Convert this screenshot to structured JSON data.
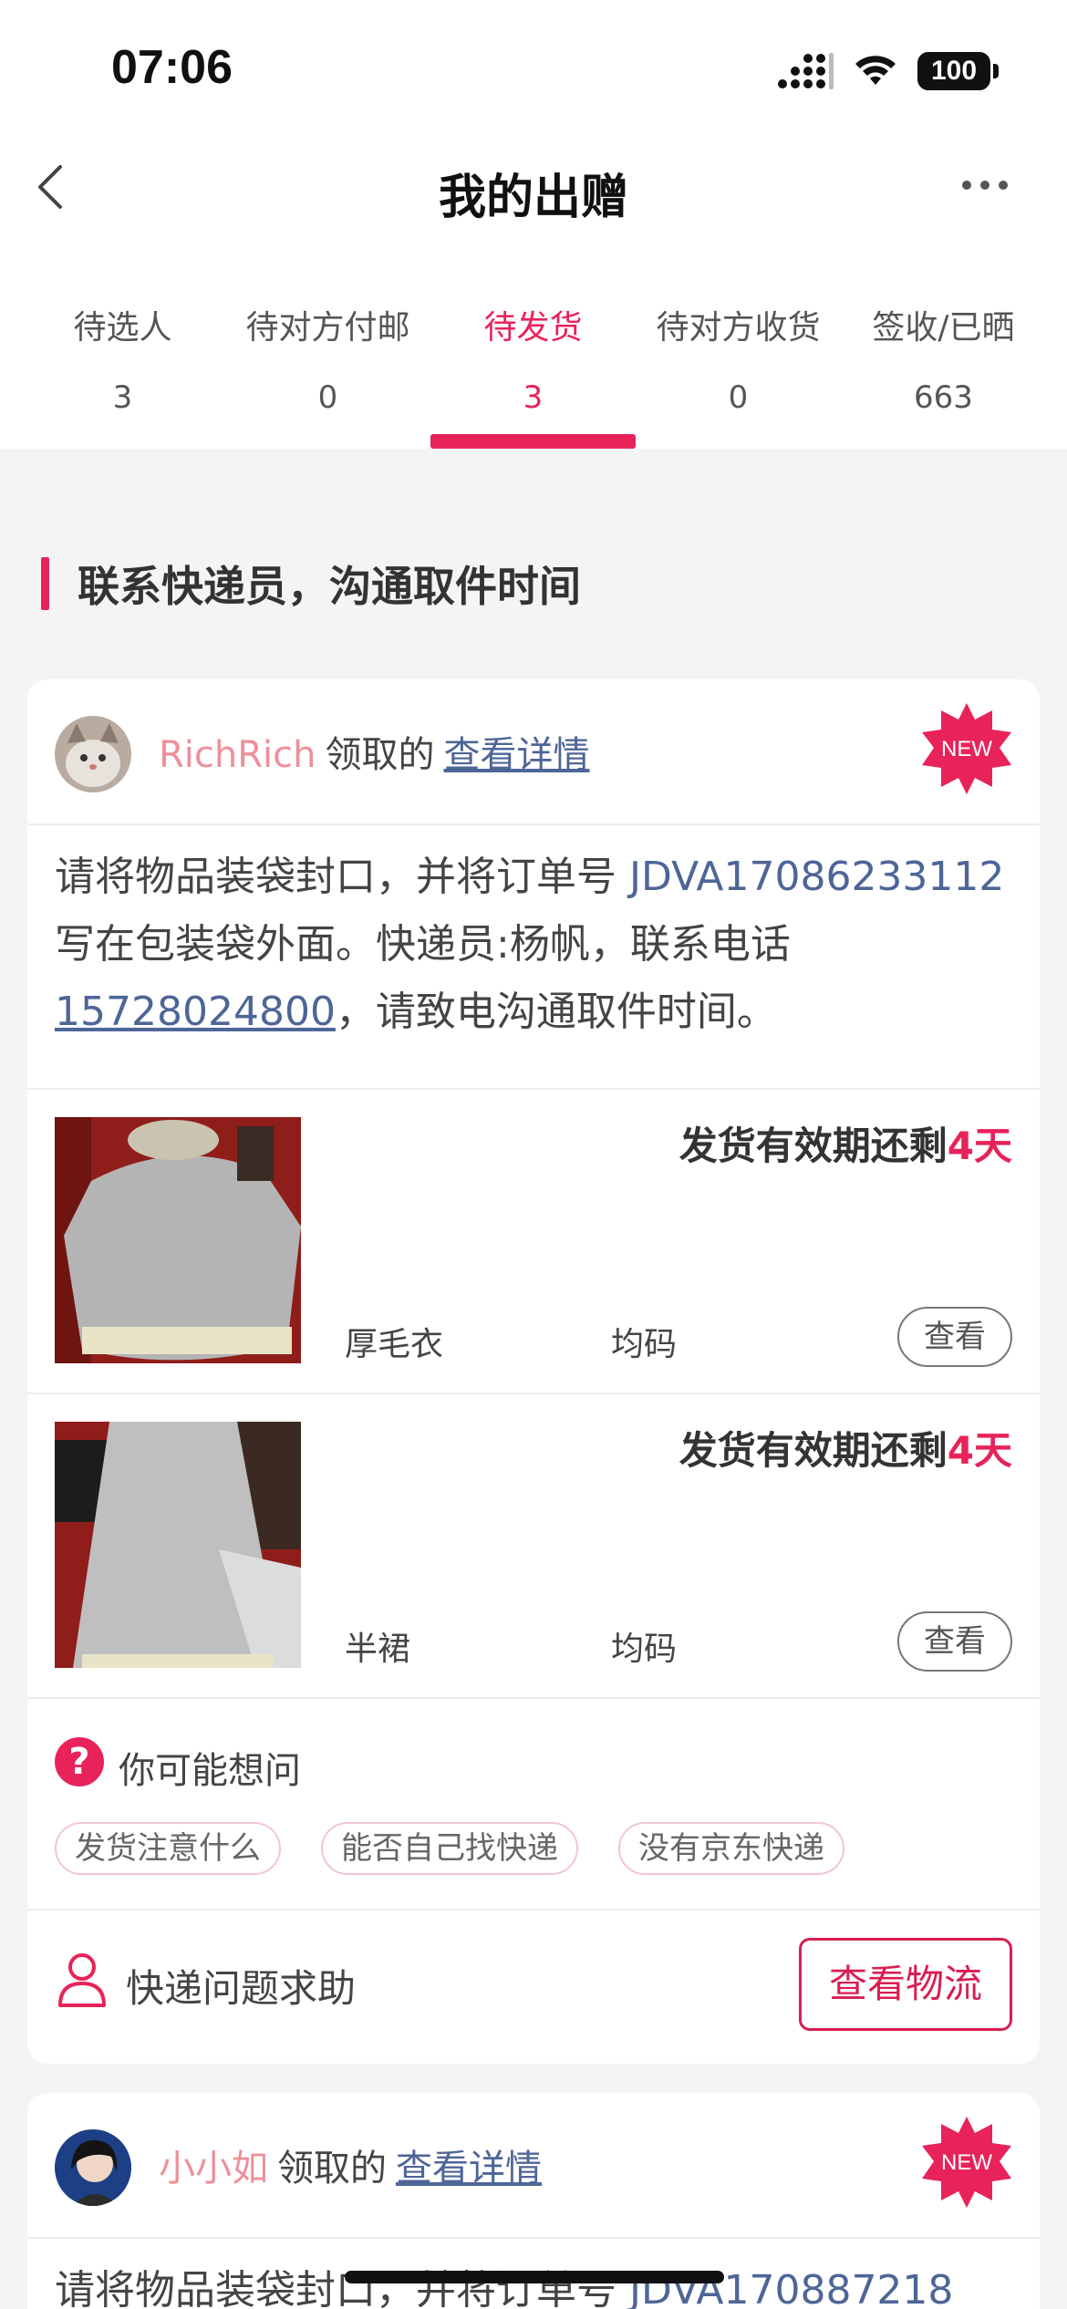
{
  "status_bar": {
    "time": "07:06",
    "battery": "100"
  },
  "nav": {
    "title": "我的出赠"
  },
  "tabs": [
    {
      "label": "待选人",
      "count": "3"
    },
    {
      "label": "待对方付邮",
      "count": "0"
    },
    {
      "label": "待发货",
      "count": "3",
      "active": true
    },
    {
      "label": "待对方收货",
      "count": "0"
    },
    {
      "label": "签收/已晒",
      "count": "663"
    }
  ],
  "section_title": "联系快递员，沟通取件时间",
  "cards": [
    {
      "username": "RichRich",
      "claimed": "领取的",
      "detail_link": "查看详情",
      "badge": "NEW",
      "instruction": {
        "prefix": "请将物品装袋封口，并将订单号 ",
        "order_no": "JDVA17086233112",
        "middle": " 写在包装袋外面。快递员:杨帆，联系电话",
        "phone": "15728024800",
        "suffix": "，请致电沟通取件时间。"
      },
      "items": [
        {
          "deadline_prefix": "发货有效期还剩",
          "deadline_days": "4天",
          "name": "厚毛衣",
          "size": "均码",
          "view": "查看"
        },
        {
          "deadline_prefix": "发货有效期还剩",
          "deadline_days": "4天",
          "name": "半裙",
          "size": "均码",
          "view": "查看"
        }
      ],
      "faq": {
        "icon": "?",
        "title": "你可能想问",
        "chips": [
          "发货注意什么",
          "能否自己找快递",
          "没有京东快递"
        ]
      },
      "help": {
        "label": "快递问题求助",
        "button": "查看物流"
      }
    },
    {
      "username": "小小如",
      "claimed": "领取的",
      "detail_link": "查看详情",
      "badge": "NEW",
      "instruction_partial": {
        "prefix": "请将物品装袋封口，并将订单号 ",
        "order_no": "JDVA170887218"
      }
    }
  ],
  "colors": {
    "accent": "#e8235a",
    "link": "#4e6597",
    "username": "#ee8f99"
  }
}
